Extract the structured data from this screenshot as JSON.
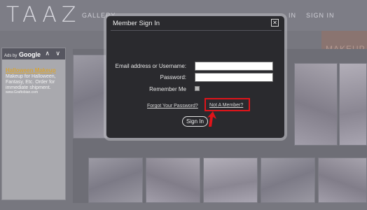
{
  "site": {
    "logo": "TAAZ",
    "nav": [
      "GALLERY",
      "IN",
      "SIGN IN"
    ],
    "promo_label": "MAKEUP"
  },
  "ad": {
    "ads_by": "Ads by",
    "google": "Google",
    "arrows": "∧ ∨",
    "title": "Halloween Makeup",
    "text": "Makeup for Halloween, Fantasy, Etc. Order for immediate shipment.",
    "url": "www.Graftobian.com"
  },
  "modal": {
    "title": "Member Sign In",
    "close_glyph": "✕",
    "email_label": "Email address or Username:",
    "email_value": "",
    "password_label": "Password:",
    "password_value": "",
    "remember_label": "Remember Me",
    "remember_checked": false,
    "forgot_link": "Forgot Your Password?",
    "not_member_link": "Not A Member?",
    "signin_button": "Sign In",
    "highlight_color": "#e0141a"
  }
}
